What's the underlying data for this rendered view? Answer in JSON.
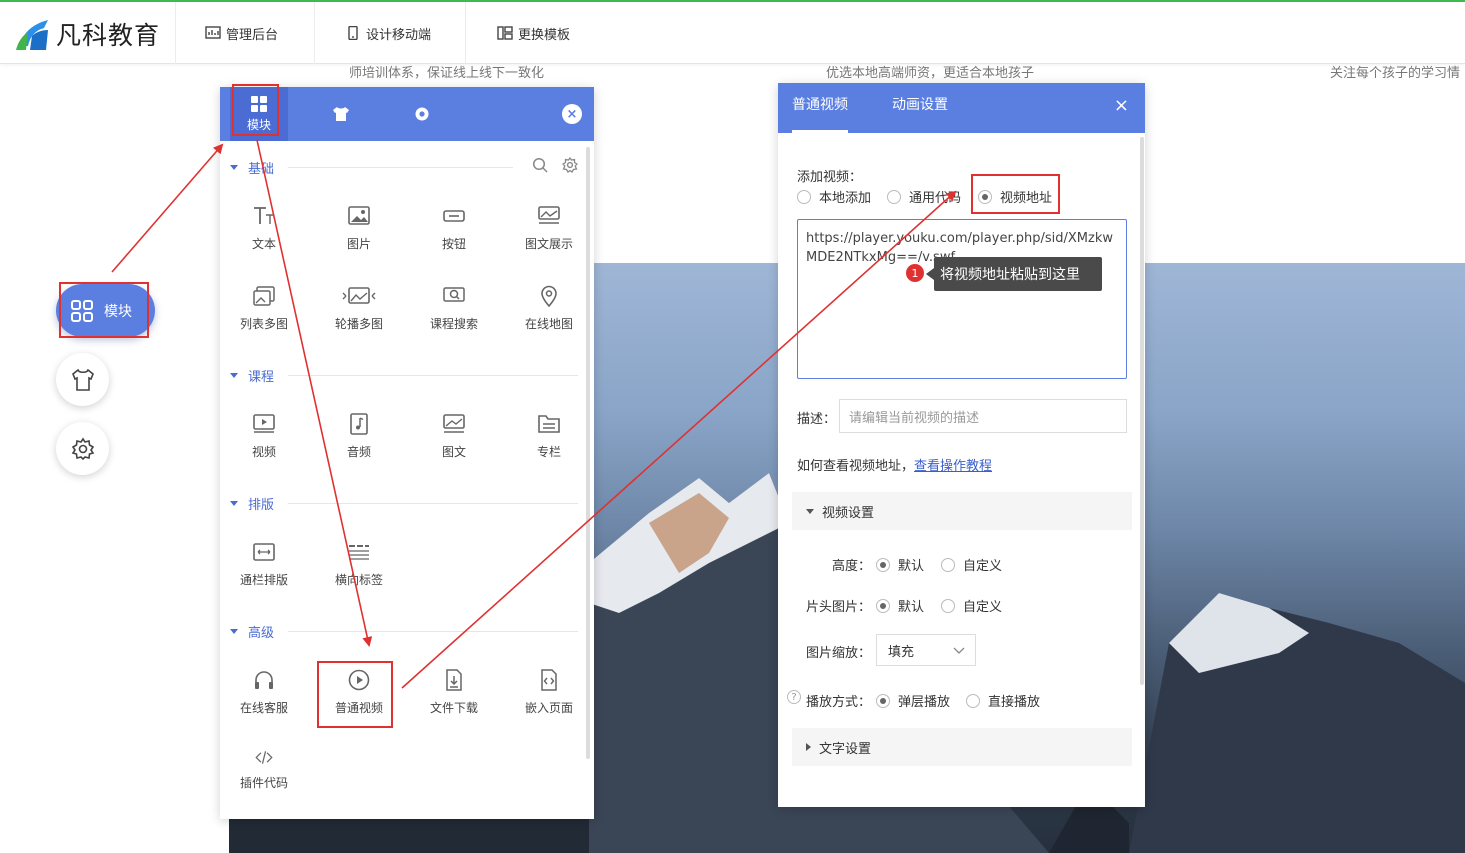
{
  "header": {
    "brand": "凡科教育",
    "nav": [
      {
        "label": "管理后台",
        "icon": "dashboard-icon"
      },
      {
        "label": "设计移动端",
        "icon": "mobile-icon"
      },
      {
        "label": "更换模板",
        "icon": "template-icon"
      }
    ]
  },
  "hero": {
    "lines": [
      "师培训体系，保证线上线下一致化",
      "优选本地高端师资，更适合本地孩子",
      "关注每个孩子的学习情"
    ]
  },
  "floating": {
    "module_label": "模块"
  },
  "module_panel": {
    "tabs": [
      {
        "label": "模块",
        "icon": "grid-icon"
      },
      {
        "label": "",
        "icon": "shirt-icon"
      },
      {
        "label": "",
        "icon": "gear-icon"
      }
    ],
    "close": "×",
    "sections": [
      {
        "title": "基础",
        "items": [
          "文本",
          "图片",
          "按钮",
          "图文展示",
          "列表多图",
          "轮播多图",
          "课程搜索",
          "在线地图"
        ]
      },
      {
        "title": "课程",
        "items": [
          "视频",
          "音频",
          "图文",
          "专栏"
        ]
      },
      {
        "title": "排版",
        "items": [
          "通栏排版",
          "横向标签"
        ]
      },
      {
        "title": "高级",
        "items": [
          "在线客服",
          "普通视频",
          "文件下载",
          "嵌入页面",
          "插件代码"
        ]
      }
    ]
  },
  "video_panel": {
    "tabs": [
      "普通视频",
      "动画设置"
    ],
    "close": "×",
    "add_video_label": "添加视频：",
    "add_video_options": [
      "本地添加",
      "通用代码",
      "视频地址"
    ],
    "add_video_selected": 2,
    "url_value": "https://player.youku.com/player.php/sid/XMzkwMDE2NTkxMg==/v.swf",
    "tooltip_badge": "1",
    "tooltip_text": "将视频地址粘贴到这里",
    "desc_label": "描述：",
    "desc_placeholder": "请编辑当前视频的描述",
    "help_text": "如何查看视频地址，",
    "help_link": "查看操作教程",
    "video_settings_title": "视频设置",
    "height_label": "高度：",
    "height_options": [
      "默认",
      "自定义"
    ],
    "cover_label": "片头图片：",
    "cover_options": [
      "默认",
      "自定义"
    ],
    "scale_label": "图片缩放：",
    "scale_value": "填充",
    "play_label": "播放方式：",
    "play_options": [
      "弹层播放",
      "直接播放"
    ],
    "help_mark": "?",
    "text_settings_title": "文字设置"
  },
  "colors": {
    "accent": "#5b7fe0",
    "highlight": "#e03131",
    "topline": "#3fb950"
  }
}
